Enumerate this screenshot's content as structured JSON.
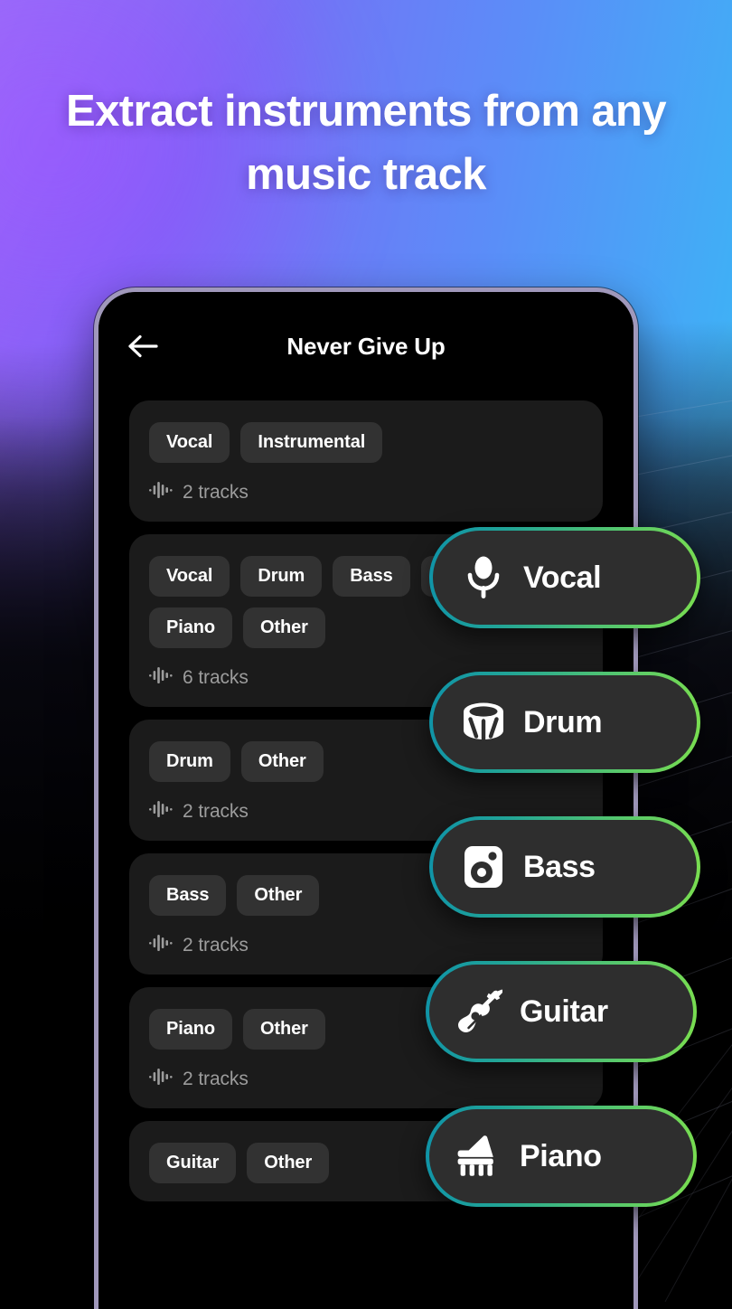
{
  "headline": "Extract instruments from any music track",
  "colors": {
    "bg_gradient_start": "#8a5cf6",
    "bg_gradient_end": "#36b9fb",
    "pill_border_start": "#0f93a8",
    "pill_border_end": "#7ade4f",
    "card_bg": "#1b1b1b",
    "chip_bg": "#323232",
    "pill_bg": "#2e2e2e",
    "screen_bg": "#000000",
    "muted_text": "#9c9c9c"
  },
  "phone": {
    "appbar": {
      "back_icon": "arrow-left-icon",
      "title": "Never Give Up"
    },
    "cards": [
      {
        "chips": [
          "Vocal",
          "Instrumental"
        ],
        "tracks": "2 tracks",
        "wave_icon": "waveform-icon"
      },
      {
        "chips": [
          "Vocal",
          "Drum",
          "Bass",
          "Guitar",
          "Piano",
          "Other"
        ],
        "tracks": "6 tracks",
        "wave_icon": "waveform-icon"
      },
      {
        "chips": [
          "Drum",
          "Other"
        ],
        "tracks": "2 tracks",
        "wave_icon": "waveform-icon"
      },
      {
        "chips": [
          "Bass",
          "Other"
        ],
        "tracks": "2 tracks",
        "wave_icon": "waveform-icon"
      },
      {
        "chips": [
          "Piano",
          "Other"
        ],
        "tracks": "2 tracks",
        "wave_icon": "waveform-icon"
      },
      {
        "chips": [
          "Guitar",
          "Other"
        ],
        "tracks": "",
        "wave_icon": "waveform-icon"
      }
    ]
  },
  "pills": [
    {
      "label": "Vocal",
      "icon": "microphone-icon"
    },
    {
      "label": "Drum",
      "icon": "drum-icon"
    },
    {
      "label": "Bass",
      "icon": "bass-amp-icon"
    },
    {
      "label": "Guitar",
      "icon": "guitar-icon"
    },
    {
      "label": "Piano",
      "icon": "piano-icon"
    }
  ]
}
